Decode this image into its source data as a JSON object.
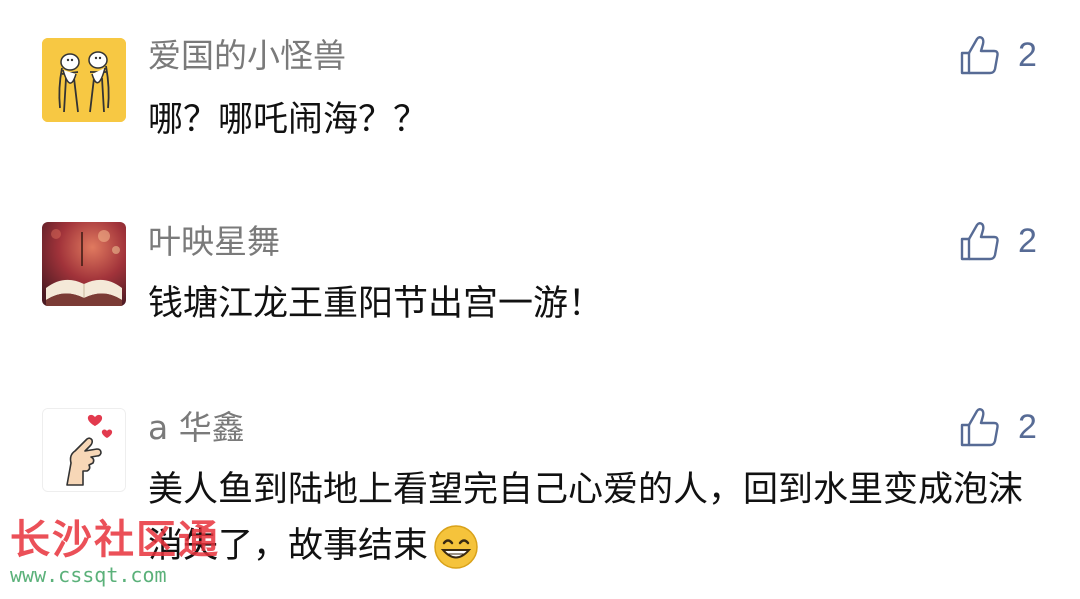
{
  "colors": {
    "username": "#7a7a7a",
    "text": "#111111",
    "like_accent": "#576b95",
    "watermark_red": "#e8323c",
    "watermark_green": "#4aa96c"
  },
  "comments": [
    {
      "avatar_icon": "cartoon-animals-avatar-icon",
      "username": "爱国的小怪兽",
      "text": "哪？哪吒闹海？？",
      "likes": "2"
    },
    {
      "avatar_icon": "open-book-avatar-icon",
      "username": "叶映星舞",
      "text": "钱塘江龙王重阳节出宫一游！",
      "likes": "2"
    },
    {
      "avatar_icon": "finger-heart-avatar-icon",
      "username": "a 华鑫",
      "text": "美人鱼到陆地上看望完自己心爱的人，回到水里变成泡沫消失了，故事结束",
      "emoji": "grinning-face-emoji",
      "likes": "2"
    }
  ],
  "watermark": {
    "title": "长沙社区通",
    "url": "www.cssqt.com"
  }
}
